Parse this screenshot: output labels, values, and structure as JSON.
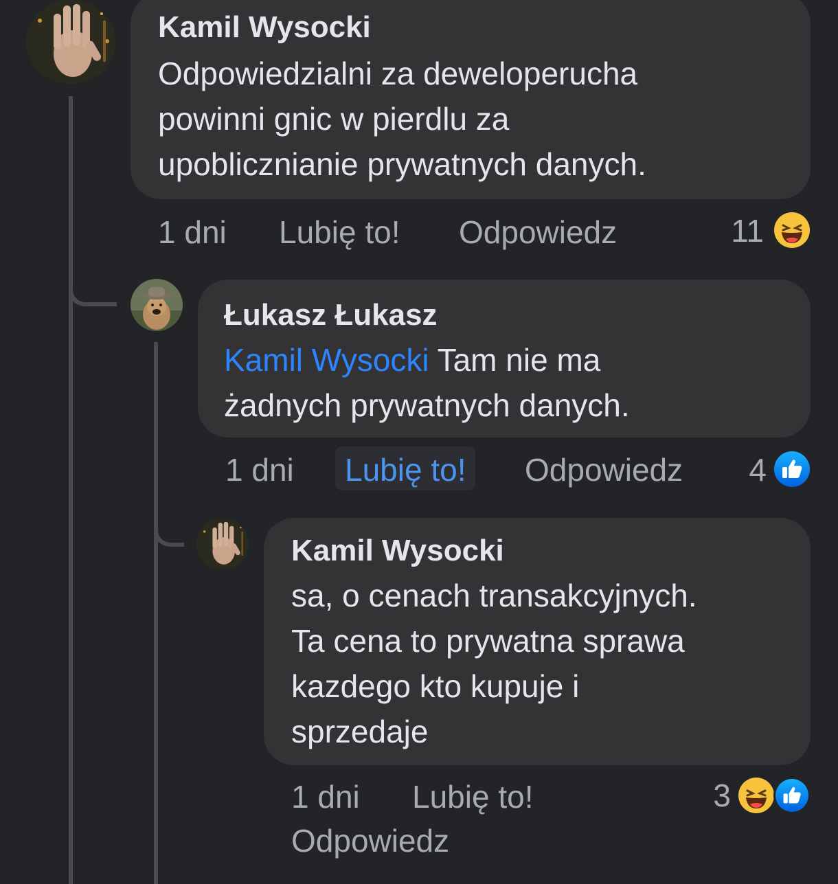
{
  "comments": [
    {
      "author": "Kamil Wysocki",
      "mention": "",
      "lines": [
        "Odpowiedzialni za deweloperucha",
        "powinni gnic w pierdlu za",
        "upoblicznianie prywatnych danych."
      ],
      "time": "1 dni",
      "like_label": "Lubię to!",
      "reply_label": "Odpowiedz",
      "reaction_count": "11",
      "reactions": [
        "haha-emoji-icon"
      ],
      "avatar_icon": "raised-hand-avatar"
    },
    {
      "author": "Łukasz Łukasz",
      "mention": "Kamil Wysocki",
      "lines": [
        "Tam nie ma",
        "żadnych prywatnych danych."
      ],
      "time": "1 dni",
      "like_label": "Lubię to!",
      "like_active": true,
      "reply_label": "Odpowiedz",
      "reaction_count": "4",
      "reactions": [
        "like-thumb-icon"
      ],
      "avatar_icon": "dog-with-hat-avatar"
    },
    {
      "author": "Kamil Wysocki",
      "mention": "",
      "lines": [
        "sa, o cenach transakcyjnych.",
        "Ta cena to prywatna sprawa",
        "kazdego kto kupuje i",
        "sprzedaje"
      ],
      "time": "1 dni",
      "like_label": "Lubię to!",
      "reply_label": "Odpowiedz",
      "reaction_count": "3",
      "reactions": [
        "haha-emoji-icon",
        "like-thumb-icon"
      ],
      "avatar_icon": "raised-hand-avatar"
    }
  ],
  "colors": {
    "background": "#232427",
    "bubble": "#333336",
    "mention": "#2d86ff",
    "active_like": "#4e94ee",
    "secondary_text": "#a8abaf",
    "like_blue": "#1877f2",
    "haha_yellow": "#f7c33d"
  }
}
